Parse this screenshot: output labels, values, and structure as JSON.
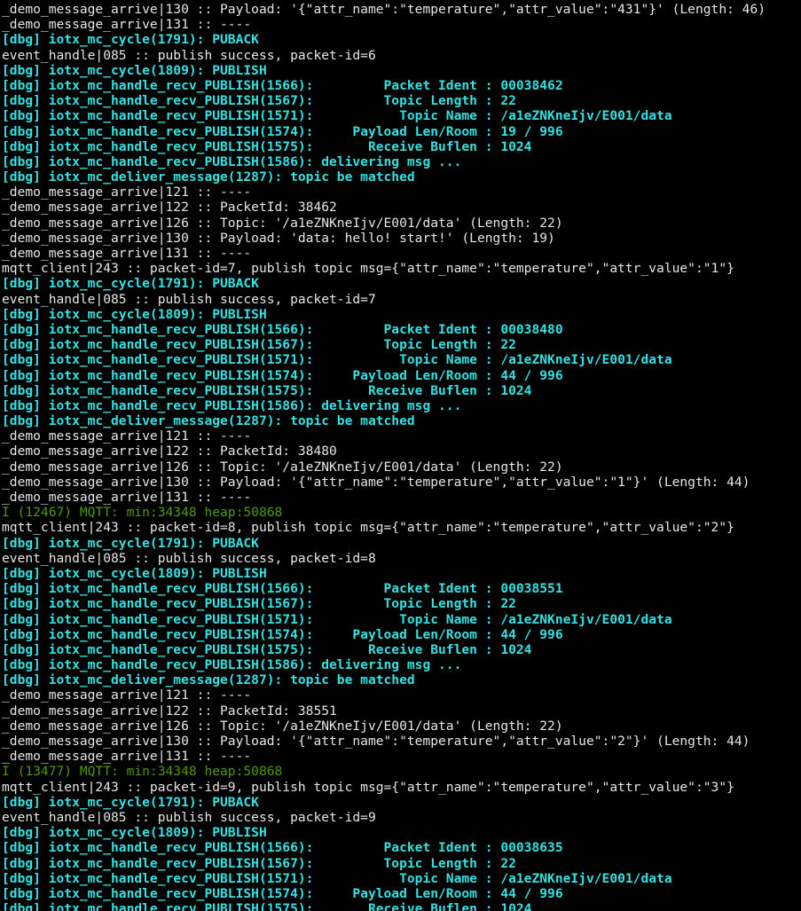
{
  "terminal": {
    "colors": {
      "background": "#000000",
      "plain": "#e6e6e6",
      "dbg": "#34e2e2",
      "info": "#4e9a06"
    },
    "lines": [
      {
        "kind": "plain",
        "text": "_demo_message_arrive|130 :: Payload: '{\"attr_name\":\"temperature\",\"attr_value\":\"431\"}' (Length: 46)"
      },
      {
        "kind": "plain",
        "text": "_demo_message_arrive|131 :: ----"
      },
      {
        "kind": "dbg",
        "text": "[dbg] iotx_mc_cycle(1791): PUBACK"
      },
      {
        "kind": "plain",
        "text": "event_handle|085 :: publish success, packet-id=6"
      },
      {
        "kind": "dbg",
        "text": "[dbg] iotx_mc_cycle(1809): PUBLISH"
      },
      {
        "kind": "dbg",
        "text": "[dbg] iotx_mc_handle_recv_PUBLISH(1566):         Packet Ident : 00038462"
      },
      {
        "kind": "dbg",
        "text": "[dbg] iotx_mc_handle_recv_PUBLISH(1567):         Topic Length : 22"
      },
      {
        "kind": "dbg",
        "text": "[dbg] iotx_mc_handle_recv_PUBLISH(1571):           Topic Name : /a1eZNKneIjv/E001/data"
      },
      {
        "kind": "dbg",
        "text": "[dbg] iotx_mc_handle_recv_PUBLISH(1574):     Payload Len/Room : 19 / 996"
      },
      {
        "kind": "dbg",
        "text": "[dbg] iotx_mc_handle_recv_PUBLISH(1575):       Receive Buflen : 1024"
      },
      {
        "kind": "dbg",
        "text": "[dbg] iotx_mc_handle_recv_PUBLISH(1586): delivering msg ..."
      },
      {
        "kind": "dbg",
        "text": "[dbg] iotx_mc_deliver_message(1287): topic be matched"
      },
      {
        "kind": "plain",
        "text": "_demo_message_arrive|121 :: ----"
      },
      {
        "kind": "plain",
        "text": "_demo_message_arrive|122 :: PacketId: 38462"
      },
      {
        "kind": "plain",
        "text": "_demo_message_arrive|126 :: Topic: '/a1eZNKneIjv/E001/data' (Length: 22)"
      },
      {
        "kind": "plain",
        "text": "_demo_message_arrive|130 :: Payload: 'data: hello! start!' (Length: 19)"
      },
      {
        "kind": "plain",
        "text": "_demo_message_arrive|131 :: ----"
      },
      {
        "kind": "plain",
        "text": "mqtt_client|243 :: packet-id=7, publish topic msg={\"attr_name\":\"temperature\",\"attr_value\":\"1\"}"
      },
      {
        "kind": "dbg",
        "text": "[dbg] iotx_mc_cycle(1791): PUBACK"
      },
      {
        "kind": "plain",
        "text": "event_handle|085 :: publish success, packet-id=7"
      },
      {
        "kind": "dbg",
        "text": "[dbg] iotx_mc_cycle(1809): PUBLISH"
      },
      {
        "kind": "dbg",
        "text": "[dbg] iotx_mc_handle_recv_PUBLISH(1566):         Packet Ident : 00038480"
      },
      {
        "kind": "dbg",
        "text": "[dbg] iotx_mc_handle_recv_PUBLISH(1567):         Topic Length : 22"
      },
      {
        "kind": "dbg",
        "text": "[dbg] iotx_mc_handle_recv_PUBLISH(1571):           Topic Name : /a1eZNKneIjv/E001/data"
      },
      {
        "kind": "dbg",
        "text": "[dbg] iotx_mc_handle_recv_PUBLISH(1574):     Payload Len/Room : 44 / 996"
      },
      {
        "kind": "dbg",
        "text": "[dbg] iotx_mc_handle_recv_PUBLISH(1575):       Receive Buflen : 1024"
      },
      {
        "kind": "dbg",
        "text": "[dbg] iotx_mc_handle_recv_PUBLISH(1586): delivering msg ..."
      },
      {
        "kind": "dbg",
        "text": "[dbg] iotx_mc_deliver_message(1287): topic be matched"
      },
      {
        "kind": "plain",
        "text": "_demo_message_arrive|121 :: ----"
      },
      {
        "kind": "plain",
        "text": "_demo_message_arrive|122 :: PacketId: 38480"
      },
      {
        "kind": "plain",
        "text": "_demo_message_arrive|126 :: Topic: '/a1eZNKneIjv/E001/data' (Length: 22)"
      },
      {
        "kind": "plain",
        "text": "_demo_message_arrive|130 :: Payload: '{\"attr_name\":\"temperature\",\"attr_value\":\"1\"}' (Length: 44)"
      },
      {
        "kind": "plain",
        "text": "_demo_message_arrive|131 :: ----"
      },
      {
        "kind": "info",
        "text": "I (12467) MQTT: min:34348 heap:50868"
      },
      {
        "kind": "plain",
        "text": "mqtt_client|243 :: packet-id=8, publish topic msg={\"attr_name\":\"temperature\",\"attr_value\":\"2\"}"
      },
      {
        "kind": "dbg",
        "text": "[dbg] iotx_mc_cycle(1791): PUBACK"
      },
      {
        "kind": "plain",
        "text": "event_handle|085 :: publish success, packet-id=8"
      },
      {
        "kind": "dbg",
        "text": "[dbg] iotx_mc_cycle(1809): PUBLISH"
      },
      {
        "kind": "dbg",
        "text": "[dbg] iotx_mc_handle_recv_PUBLISH(1566):         Packet Ident : 00038551"
      },
      {
        "kind": "dbg",
        "text": "[dbg] iotx_mc_handle_recv_PUBLISH(1567):         Topic Length : 22"
      },
      {
        "kind": "dbg",
        "text": "[dbg] iotx_mc_handle_recv_PUBLISH(1571):           Topic Name : /a1eZNKneIjv/E001/data"
      },
      {
        "kind": "dbg",
        "text": "[dbg] iotx_mc_handle_recv_PUBLISH(1574):     Payload Len/Room : 44 / 996"
      },
      {
        "kind": "dbg",
        "text": "[dbg] iotx_mc_handle_recv_PUBLISH(1575):       Receive Buflen : 1024"
      },
      {
        "kind": "dbg",
        "text": "[dbg] iotx_mc_handle_recv_PUBLISH(1586): delivering msg ..."
      },
      {
        "kind": "dbg",
        "text": "[dbg] iotx_mc_deliver_message(1287): topic be matched"
      },
      {
        "kind": "plain",
        "text": "_demo_message_arrive|121 :: ----"
      },
      {
        "kind": "plain",
        "text": "_demo_message_arrive|122 :: PacketId: 38551"
      },
      {
        "kind": "plain",
        "text": "_demo_message_arrive|126 :: Topic: '/a1eZNKneIjv/E001/data' (Length: 22)"
      },
      {
        "kind": "plain",
        "text": "_demo_message_arrive|130 :: Payload: '{\"attr_name\":\"temperature\",\"attr_value\":\"2\"}' (Length: 44)"
      },
      {
        "kind": "plain",
        "text": "_demo_message_arrive|131 :: ----"
      },
      {
        "kind": "info",
        "text": "I (13477) MQTT: min:34348 heap:50868"
      },
      {
        "kind": "plain",
        "text": "mqtt_client|243 :: packet-id=9, publish topic msg={\"attr_name\":\"temperature\",\"attr_value\":\"3\"}"
      },
      {
        "kind": "dbg",
        "text": "[dbg] iotx_mc_cycle(1791): PUBACK"
      },
      {
        "kind": "plain",
        "text": "event_handle|085 :: publish success, packet-id=9"
      },
      {
        "kind": "dbg",
        "text": "[dbg] iotx_mc_cycle(1809): PUBLISH"
      },
      {
        "kind": "dbg",
        "text": "[dbg] iotx_mc_handle_recv_PUBLISH(1566):         Packet Ident : 00038635"
      },
      {
        "kind": "dbg",
        "text": "[dbg] iotx_mc_handle_recv_PUBLISH(1567):         Topic Length : 22"
      },
      {
        "kind": "dbg",
        "text": "[dbg] iotx_mc_handle_recv_PUBLISH(1571):           Topic Name : /a1eZNKneIjv/E001/data"
      },
      {
        "kind": "dbg",
        "text": "[dbg] iotx_mc_handle_recv_PUBLISH(1574):     Payload Len/Room : 44 / 996"
      },
      {
        "kind": "dbg",
        "text": "[dbg] iotx_mc_handle_recv_PUBLISH(1575):       Receive Buflen : 1024"
      }
    ]
  }
}
